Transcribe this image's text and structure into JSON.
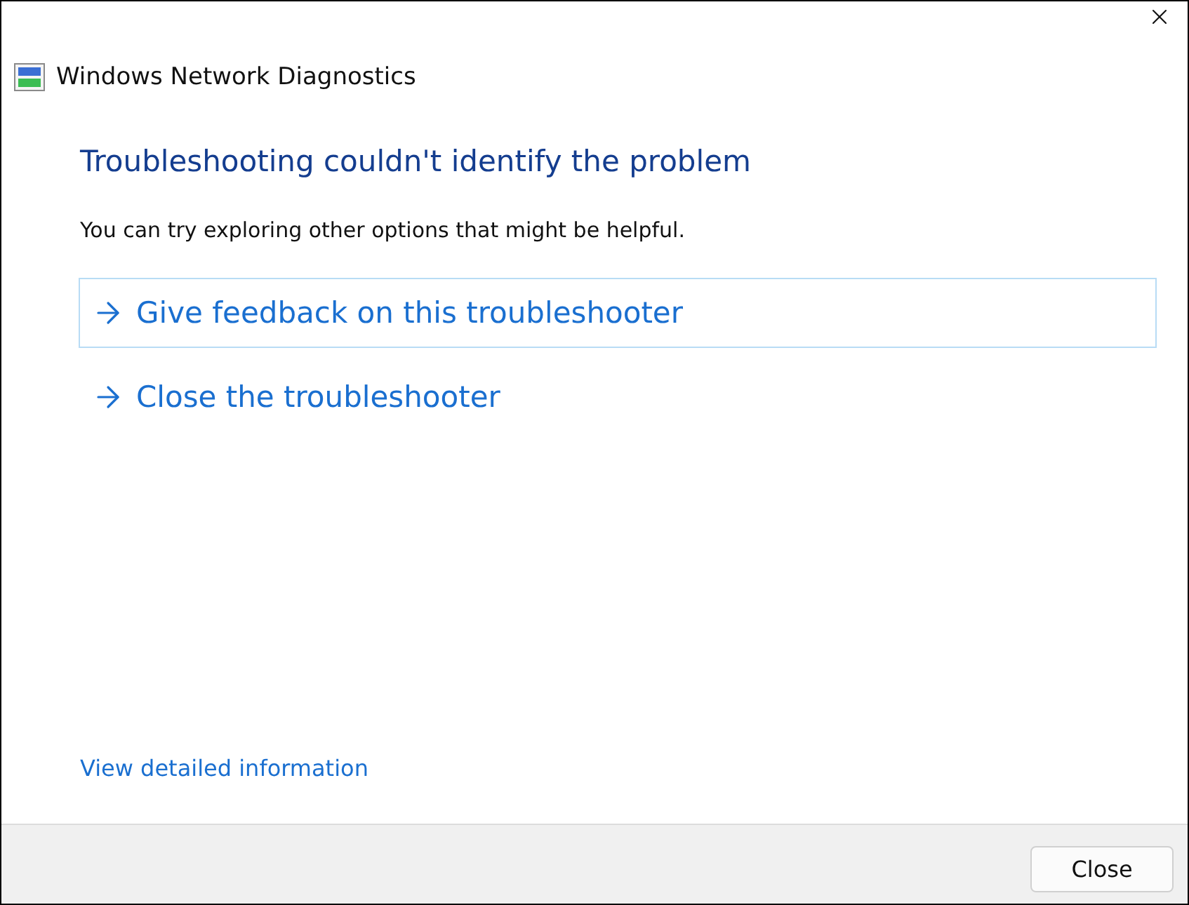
{
  "window": {
    "title": "Windows Network Diagnostics"
  },
  "heading": "Troubleshooting couldn't identify the problem",
  "message": "You can try exploring other options that might be helpful.",
  "options": [
    {
      "label": "Give feedback on this troubleshooter",
      "focused": true
    },
    {
      "label": "Close the troubleshooter",
      "focused": false
    }
  ],
  "details_link": "View detailed information",
  "buttons": [
    "Close"
  ]
}
